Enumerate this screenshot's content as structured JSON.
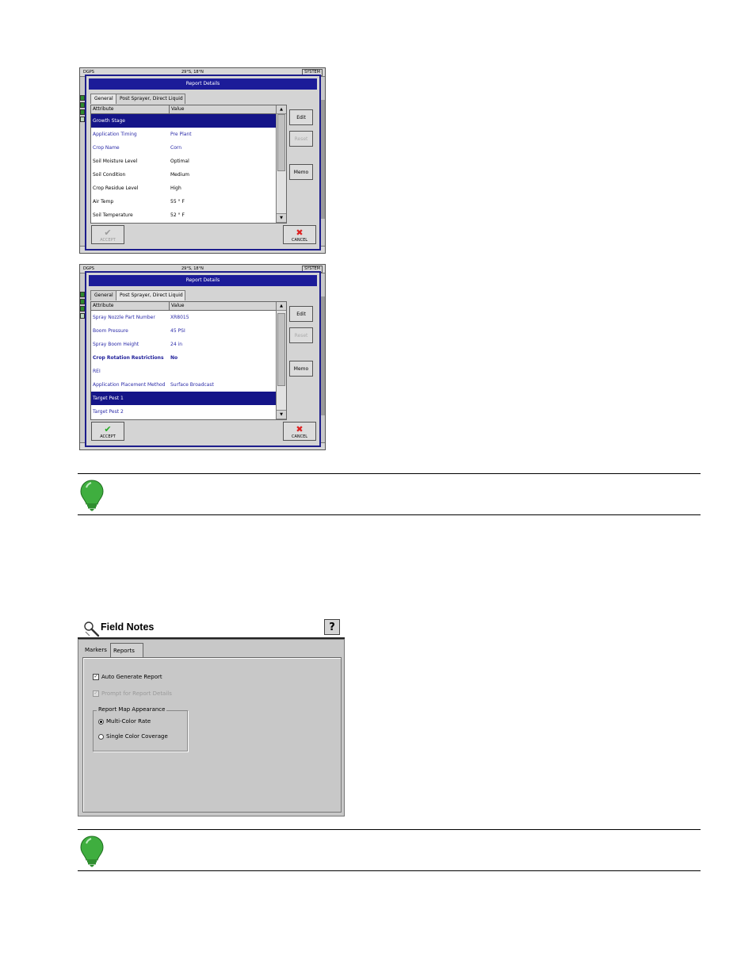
{
  "report1": {
    "sysbar": {
      "left": "DGPS",
      "center": "29°S, 18°N",
      "right": "SYSTEM"
    },
    "title": "Report Details",
    "tabs": [
      "General",
      "Post Sprayer, Direct Liquid"
    ],
    "headers": {
      "attribute": "Attribute",
      "value": "Value"
    },
    "rows": [
      {
        "attribute": "Growth Stage",
        "value": "",
        "style": "selected"
      },
      {
        "attribute": "Application Timing",
        "value": "Pre Plant",
        "style": "blue"
      },
      {
        "attribute": "Crop Name",
        "value": "Corn",
        "style": "blue"
      },
      {
        "attribute": "Soil Moisture Level",
        "value": "Optimal",
        "style": "normal"
      },
      {
        "attribute": "Soil Condition",
        "value": "Medium",
        "style": "normal"
      },
      {
        "attribute": "Crop Residue Level",
        "value": "High",
        "style": "normal"
      },
      {
        "attribute": "Air Temp",
        "value": "55 ° F",
        "style": "normal"
      },
      {
        "attribute": "Soil Temperature",
        "value": "52 ° F",
        "style": "normal"
      }
    ],
    "buttons": {
      "edit": "Edit",
      "reset": "Reset",
      "memo": "Memo",
      "accept": "ACCEPT",
      "cancel": "CANCEL"
    }
  },
  "report2": {
    "sysbar": {
      "left": "DGPS",
      "center": "29°S, 18°N",
      "right": "SYSTEM"
    },
    "title": "Report Details",
    "tabs": [
      "General",
      "Post Sprayer, Direct Liquid"
    ],
    "headers": {
      "attribute": "Attribute",
      "value": "Value"
    },
    "rows": [
      {
        "attribute": "Spray Nozzle Part Number",
        "value": "XR8015",
        "style": "blue"
      },
      {
        "attribute": "Boom Pressure",
        "value": "45 PSI",
        "style": "blue"
      },
      {
        "attribute": "Spray Boom Height",
        "value": "24 in",
        "style": "blue"
      },
      {
        "attribute": "Crop Rotation Restrictions",
        "value": "No",
        "style": "bold"
      },
      {
        "attribute": "REI",
        "value": "",
        "style": "blue"
      },
      {
        "attribute": "Application Placement Method",
        "value": "Surface Broadcast",
        "style": "blue"
      },
      {
        "attribute": "Target Pest 1",
        "value": "",
        "style": "selected"
      },
      {
        "attribute": "Target Pest 2",
        "value": "",
        "style": "blue"
      }
    ],
    "buttons": {
      "edit": "Edit",
      "reset": "Reset",
      "memo": "Memo",
      "accept": "ACCEPT",
      "cancel": "CANCEL"
    }
  },
  "field_notes": {
    "title": "Field Notes",
    "help": "?",
    "tabs": [
      "Markers",
      "Reports"
    ],
    "auto_generate": "Auto Generate Report",
    "prompt_details": "Prompt for Report Details",
    "group_label": "Report Map Appearance",
    "radio_multi": "Multi-Color Rate",
    "radio_single": "Single Color Coverage"
  },
  "colors": {
    "accent": "#1c1c99",
    "bulb": "#3fae3f"
  }
}
